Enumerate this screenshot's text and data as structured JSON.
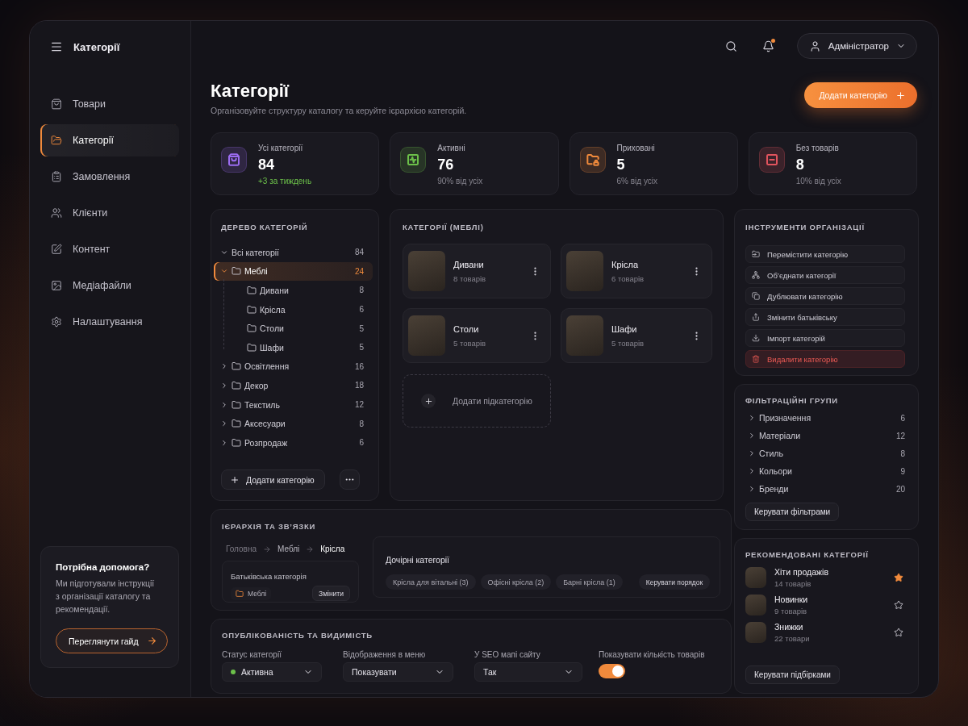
{
  "sidebar": {
    "title": "Категорії",
    "nav": [
      {
        "label": "Товари",
        "kind": "products",
        "selected": false
      },
      {
        "label": "Категорії",
        "kind": "categories",
        "selected": true
      },
      {
        "label": "Замовлення",
        "kind": "orders",
        "selected": false
      },
      {
        "label": "Клієнти",
        "kind": "clients",
        "selected": false
      },
      {
        "label": "Контент",
        "kind": "content",
        "selected": false
      },
      {
        "label": "Медіафайли",
        "kind": "media",
        "selected": false
      },
      {
        "label": "Налаштування",
        "kind": "settings",
        "selected": false
      }
    ],
    "help": {
      "title": "Потрібна допомога?",
      "text": "Ми підготували інструкції з організації каталогу та рекомендації.",
      "button": "Переглянути гайд"
    }
  },
  "topbar": {
    "notifications_unread": true,
    "user": "Адміністратор"
  },
  "header": {
    "title": "Категорії",
    "subtitle": "Організовуйте структуру каталогу та керуйте ієрархією категорій.",
    "button": "Додати категорію"
  },
  "stats": [
    {
      "label": "Усі категорії",
      "value": "84",
      "note": "+3 за тиждень",
      "positive": true,
      "kind": "all",
      "color": "#9b6cf0"
    },
    {
      "label": "Активні",
      "value": "76",
      "note": "90% від усіх",
      "positive": false,
      "kind": "active",
      "color": "#6cc04a"
    },
    {
      "label": "Приховані",
      "value": "5",
      "note": "6% від усіх",
      "positive": false,
      "kind": "hidden",
      "color": "#f08a3c"
    },
    {
      "label": "Без товарів",
      "value": "8",
      "note": "10% від усіх",
      "positive": false,
      "kind": "empty",
      "color": "#e2545e"
    }
  ],
  "tree": {
    "title": "ДЕРЕВО КАТЕГОРІЙ",
    "items": [
      {
        "label": "Всі категорії",
        "count": "84",
        "selected": false,
        "expanded": true,
        "children": [
          {
            "label": "Меблі",
            "count": "24",
            "selected": true,
            "expanded": true,
            "children": [
              {
                "label": "Дивани",
                "count": "8",
                "selected": false
              },
              {
                "label": "Крісла",
                "count": "6",
                "selected": false
              },
              {
                "label": "Столи",
                "count": "5",
                "selected": false
              },
              {
                "label": "Шафи",
                "count": "5",
                "selected": false
              }
            ]
          },
          {
            "label": "Освітлення",
            "count": "16",
            "selected": false,
            "expanded": false
          },
          {
            "label": "Декор",
            "count": "18",
            "selected": false,
            "expanded": false
          },
          {
            "label": "Текстиль",
            "count": "12",
            "selected": false,
            "expanded": false
          },
          {
            "label": "Аксесуари",
            "count": "8",
            "selected": false,
            "expanded": false
          },
          {
            "label": "Розпродаж",
            "count": "6",
            "selected": false,
            "expanded": false
          }
        ]
      }
    ],
    "add_button": "Додати категорію"
  },
  "categories": {
    "title": "КАТЕГОРІЇ (МЕБЛІ)",
    "cards": [
      {
        "name": "Дивани",
        "count": "8 товарів"
      },
      {
        "name": "Крісла",
        "count": "6 товарів"
      },
      {
        "name": "Столи",
        "count": "5 товарів"
      },
      {
        "name": "Шафи",
        "count": "5 товарів"
      }
    ],
    "add_card": "Додати підкатегорію"
  },
  "hierarchy": {
    "title": "ІЄРАРХІЯ ТА ЗВ’ЯЗКИ",
    "breadcrumb": [
      {
        "label": "Головна",
        "current": false
      },
      {
        "label": "Меблі",
        "current": false
      },
      {
        "label": "Крісла",
        "current": true
      }
    ],
    "parent": {
      "label": "Батьківська категорія",
      "value": "Меблі",
      "button": "Змінити"
    },
    "children": {
      "title": "Дочірні категорії",
      "chips": [
        "Крісла для вітальні (3)",
        "Офісні крісла (2)",
        "Барні крісла (1)"
      ],
      "button": "Керувати порядок"
    }
  },
  "visibility": {
    "title": "ОПУБЛІКОВАНІСТЬ ТА ВИДИМІСТЬ",
    "selects": [
      {
        "label": "Статус категорії",
        "value": "Активна",
        "color": "#6cc04a"
      },
      {
        "label": "Відображення в меню",
        "value": "Показувати"
      },
      {
        "label": "У SEO мапі сайту",
        "value": "Так"
      }
    ],
    "toggle": {
      "label": "Показувати кількість товарів",
      "on": true
    }
  },
  "tools": {
    "title": "ІНСТРУМЕНТИ ОРГАНІЗАЦІЇ",
    "actions": [
      {
        "label": "Перемістити категорію",
        "kind": "move"
      },
      {
        "label": "Об’єднати категорії",
        "kind": "merge"
      },
      {
        "label": "Дублювати категорію",
        "kind": "duplicate"
      },
      {
        "label": "Змінити батьківську",
        "kind": "reparent"
      },
      {
        "label": "Імпорт категорій",
        "kind": "import"
      },
      {
        "label": "Видалити категорію",
        "kind": "delete"
      }
    ]
  },
  "filters": {
    "title": "ФІЛЬТРАЦІЙНІ ГРУПИ",
    "groups": [
      {
        "label": "Призначення",
        "count": "6",
        "expanded": false
      },
      {
        "label": "Матеріали",
        "count": "12",
        "expanded": false
      },
      {
        "label": "Стиль",
        "count": "8",
        "expanded": false
      },
      {
        "label": "Кольори",
        "count": "9",
        "expanded": false
      },
      {
        "label": "Бренди",
        "count": "20",
        "expanded": false
      }
    ],
    "button": "Керувати фільтрами"
  },
  "featured": {
    "title": "РЕКОМЕНДОВАНІ КАТЕГОРІЇ",
    "items": [
      {
        "name": "Хіти продажів",
        "count": "14 товарів",
        "starred": true
      },
      {
        "name": "Новинки",
        "count": "9 товарів",
        "starred": false
      },
      {
        "name": "Знижки",
        "count": "22 товари",
        "starred": false
      }
    ],
    "button": "Керувати підбірками"
  }
}
